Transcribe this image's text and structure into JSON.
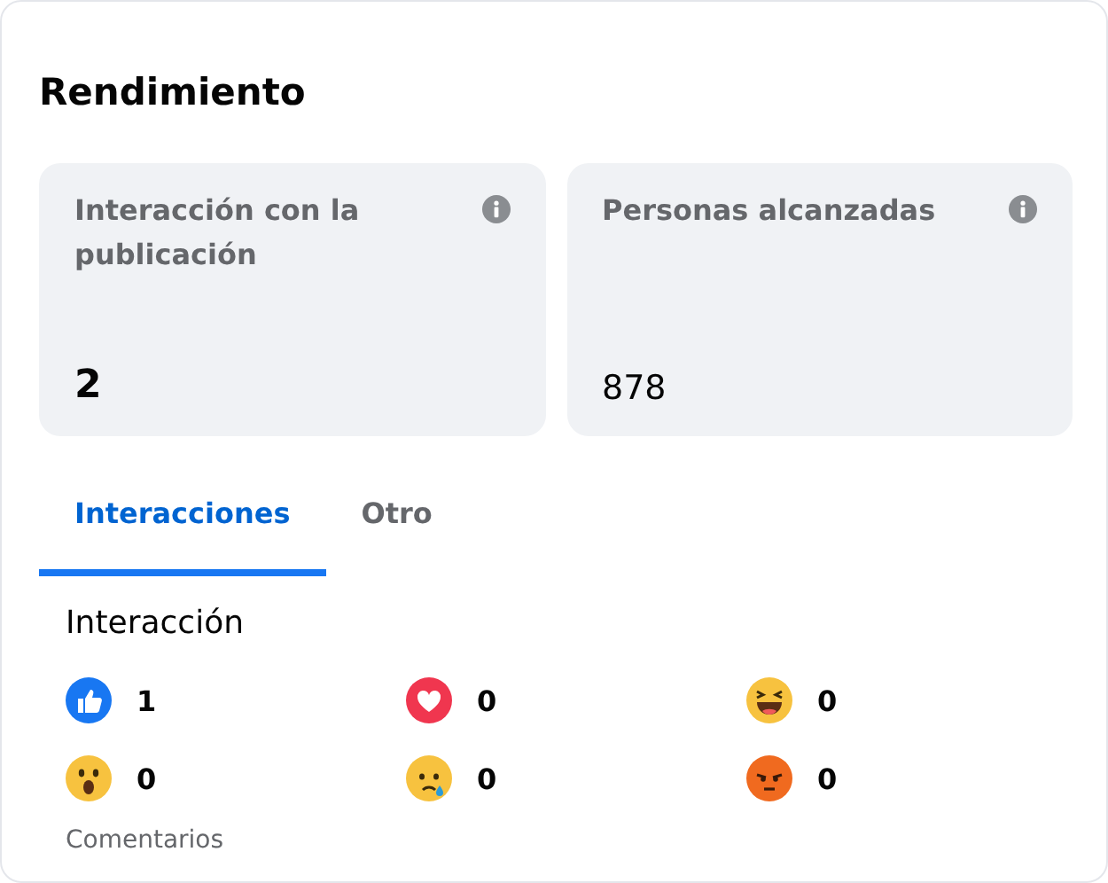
{
  "title": "Rendimiento",
  "stats": [
    {
      "label": "Interacción con la publicación",
      "value": "2",
      "bold": true
    },
    {
      "label": "Personas alcanzadas",
      "value": "878",
      "bold": false
    }
  ],
  "tabs": [
    {
      "label": "Interacciones",
      "selected": true
    },
    {
      "label": "Otro",
      "selected": false
    }
  ],
  "section_title": "Interacción",
  "reactions": [
    {
      "kind": "like",
      "count": "1"
    },
    {
      "kind": "love",
      "count": "0"
    },
    {
      "kind": "haha",
      "count": "0"
    },
    {
      "kind": "wow",
      "count": "0"
    },
    {
      "kind": "sad",
      "count": "0"
    },
    {
      "kind": "angry",
      "count": "0"
    }
  ],
  "next_section": "Comentarios"
}
